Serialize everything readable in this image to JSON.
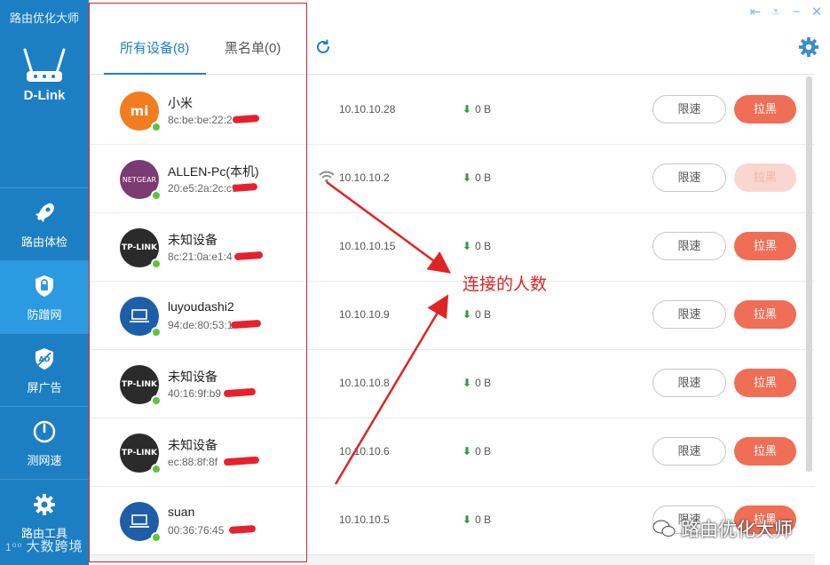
{
  "app": {
    "title": "路由优化大师",
    "brand": "D-Link"
  },
  "nav": [
    {
      "label": "路由体检",
      "icon": "rocket-icon"
    },
    {
      "label": "防蹭网",
      "icon": "lock-shield-icon",
      "active": true
    },
    {
      "label": "屏广告",
      "icon": "ad-block-shield-icon"
    },
    {
      "label": "测网速",
      "icon": "speedometer-icon"
    },
    {
      "label": "路由工具",
      "icon": "gear-icon"
    }
  ],
  "tabs": {
    "all": "所有设备(8)",
    "blacklist": "黑名单(0)"
  },
  "devices": [
    {
      "name": "小米",
      "mac": "8c:be:be:22:2",
      "ip": "10.10.10.28",
      "speed": "0 B",
      "avatar": "xiaomi-logo",
      "limit": "限速",
      "block": "拉黑"
    },
    {
      "name": "ALLEN-Pc(本机)",
      "mac": "20:e5:2a:2c:c9",
      "ip": "10.10.10.2",
      "speed": "0 B",
      "avatar": "netgear-logo",
      "limit": "限速",
      "block": "拉黑",
      "wifi": true,
      "block_disabled": true
    },
    {
      "name": "未知设备",
      "mac": "8c:21:0a:e1:4",
      "ip": "10.10.10.15",
      "speed": "0 B",
      "avatar": "tplink-logo",
      "limit": "限速",
      "block": "拉黑"
    },
    {
      "name": "luyoudashi2",
      "mac": "94:de:80:53:1",
      "ip": "10.10.10.9",
      "speed": "0 B",
      "avatar": "laptop-icon",
      "limit": "限速",
      "block": "拉黑"
    },
    {
      "name": "未知设备",
      "mac": "40:16:9f:b9",
      "ip": "10.10.10.8",
      "speed": "0 B",
      "avatar": "tplink-logo",
      "limit": "限速",
      "block": "拉黑"
    },
    {
      "name": "未知设备",
      "mac": "ec:88:8f:8f",
      "ip": "10.10.10.6",
      "speed": "0 B",
      "avatar": "tplink-logo",
      "limit": "限速",
      "block": "拉黑"
    },
    {
      "name": "suan",
      "mac": "00:36:76:45",
      "ip": "10.10.10.5",
      "speed": "0 B",
      "avatar": "laptop-icon",
      "limit": "限速",
      "block": "拉黑"
    }
  ],
  "annotation": {
    "label": "连接的人数",
    "color": "#e02424"
  },
  "watermarks": {
    "left": "大数跨境",
    "right": "路由优化大师"
  },
  "colors": {
    "sidebar": "#1d7fc3",
    "accent": "#1d7fc3",
    "block_button": "#f06e55",
    "online": "#5ec340"
  }
}
